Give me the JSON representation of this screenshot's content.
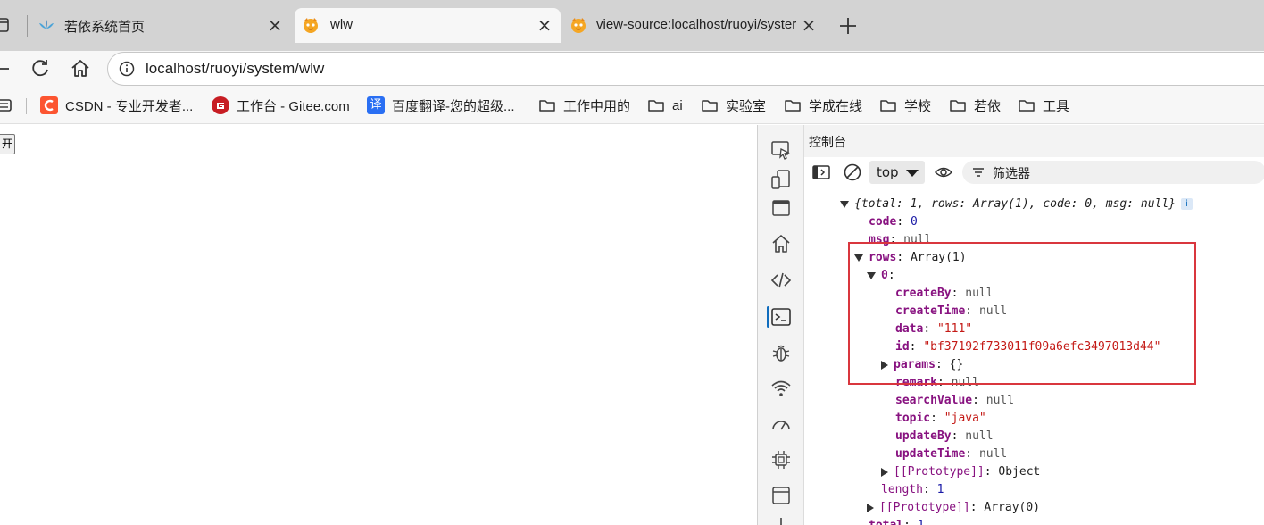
{
  "tabs": [
    {
      "title": "若依系统首页",
      "active": false
    },
    {
      "title": "wlw",
      "active": true
    },
    {
      "title": "view-source:localhost/ruoyi/syster",
      "active": false
    }
  ],
  "address": {
    "url": "localhost/ruoyi/system/wlw"
  },
  "bookmarks": [
    {
      "label": "CSDN - 专业开发者...",
      "icon": "csdn-icon"
    },
    {
      "label": "工作台 - Gitee.com",
      "icon": "gitee-icon"
    },
    {
      "label": "百度翻译-您的超级...",
      "icon": "baidu-translate-icon",
      "icon_text": "译"
    },
    {
      "label": "工作中用的",
      "icon": "folder-icon"
    },
    {
      "label": "ai",
      "icon": "folder-icon"
    },
    {
      "label": "实验室",
      "icon": "folder-icon"
    },
    {
      "label": "学成在线",
      "icon": "folder-icon"
    },
    {
      "label": "学校",
      "icon": "folder-icon"
    },
    {
      "label": "若依",
      "icon": "folder-icon"
    },
    {
      "label": "工具",
      "icon": "folder-icon"
    }
  ],
  "page": {
    "button_label": "开"
  },
  "devtools": {
    "panel_title": "控制台",
    "context": "top",
    "filter_placeholder": "筛选器",
    "console": {
      "summary": "{total: 1, rows: Array(1), code: 0, msg: null}",
      "summary_badge": "i",
      "code": {
        "key": "code",
        "value": "0"
      },
      "msg": {
        "key": "msg",
        "value": "null"
      },
      "rows": {
        "key": "rows",
        "value": "Array(1)"
      },
      "row0": {
        "key": "0",
        "sep": ":"
      },
      "fields": [
        {
          "key": "createBy",
          "value": "null",
          "type": "null"
        },
        {
          "key": "createTime",
          "value": "null",
          "type": "null"
        },
        {
          "key": "data",
          "value": "\"111\"",
          "type": "string"
        },
        {
          "key": "id",
          "value": "\"bf37192f733011f09a6efc3497013d44\"",
          "type": "string"
        },
        {
          "key": "params",
          "value": "{}",
          "type": "object"
        },
        {
          "key": "remark",
          "value": "null",
          "type": "null"
        },
        {
          "key": "searchValue",
          "value": "null",
          "type": "null"
        },
        {
          "key": "topic",
          "value": "\"java\"",
          "type": "string"
        },
        {
          "key": "updateBy",
          "value": "null",
          "type": "null"
        },
        {
          "key": "updateTime",
          "value": "null",
          "type": "null"
        }
      ],
      "row_proto": {
        "key": "[[Prototype]]",
        "value": "Object"
      },
      "length": {
        "key": "length",
        "value": "1"
      },
      "rows_proto": {
        "key": "[[Prototype]]",
        "value": "Array(0)"
      },
      "total": {
        "key": "total",
        "value": "1"
      }
    }
  },
  "colors": {
    "accent": "#0f6cbd",
    "highlight_box": "#d9363e",
    "key": "#881280",
    "string": "#c41a16",
    "number": "#1a1aa6"
  }
}
